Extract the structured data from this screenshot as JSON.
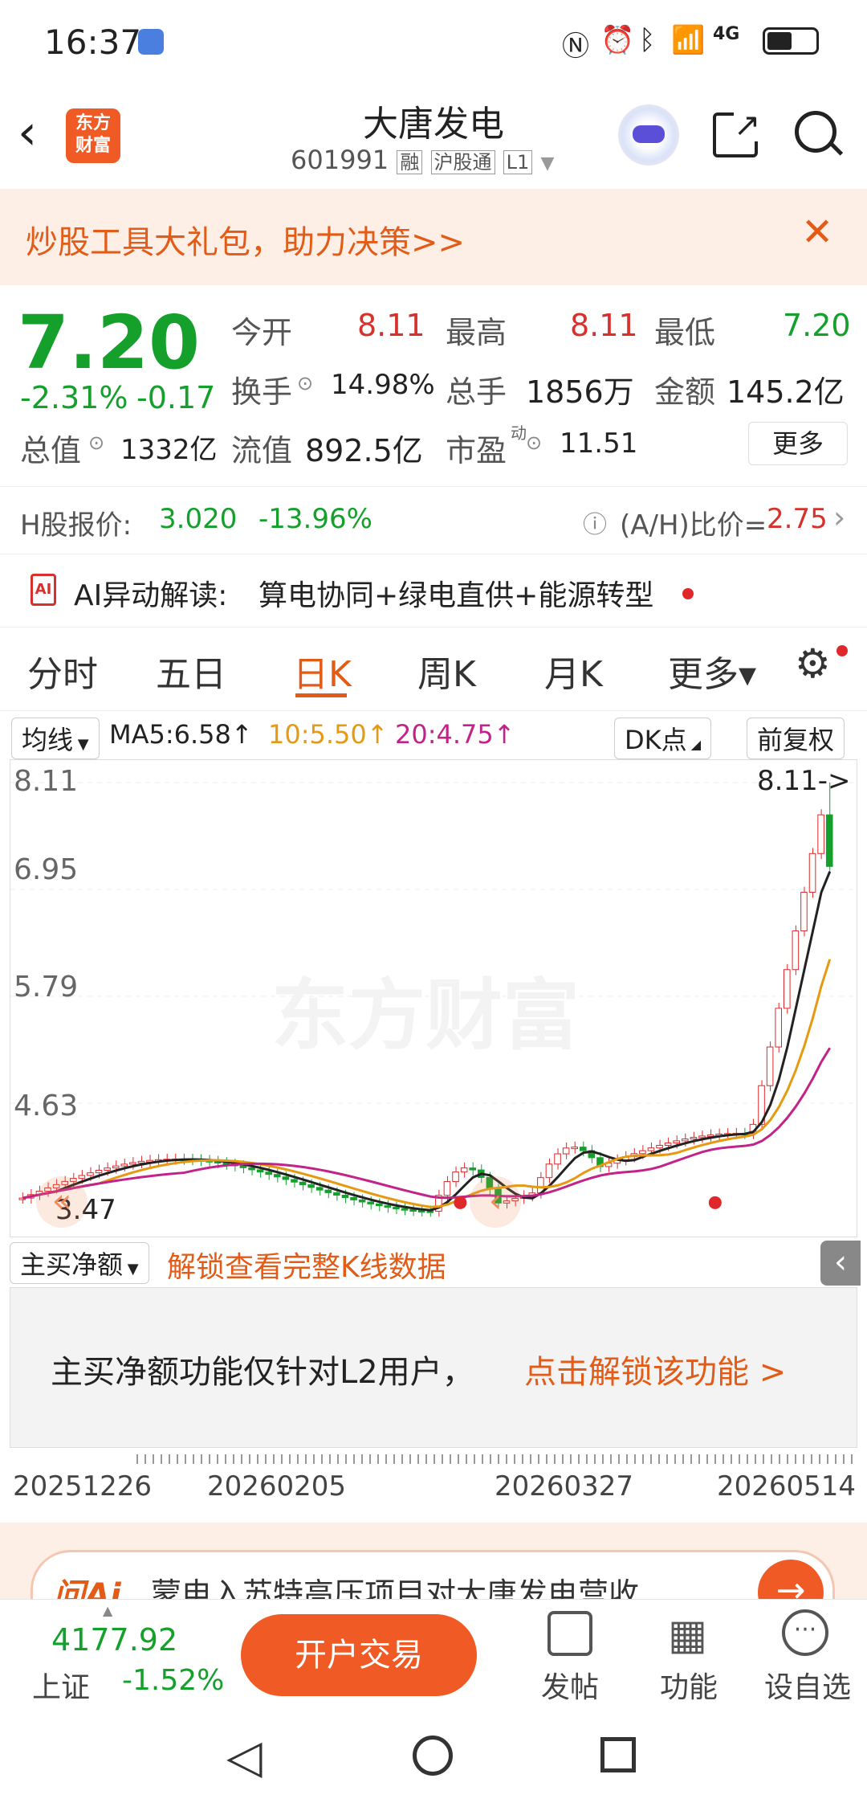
{
  "status": {
    "time": "16:37",
    "network": "4G"
  },
  "header": {
    "logo_text": "东方\n财富",
    "title": "大唐发电",
    "code": "601991",
    "badge_rong": "融",
    "badge_hgt": "沪股通",
    "badge_l1": "L1"
  },
  "banner": {
    "text": "炒股工具大礼包，助力决策>>"
  },
  "quote": {
    "price": "7.20",
    "change_pct": "-2.31%",
    "change": "-0.17",
    "open_label": "今开",
    "open": "8.11",
    "high_label": "最高",
    "high": "8.11",
    "low_label": "最低",
    "low": "7.20",
    "turnover_label": "换手",
    "turnover": "14.98%",
    "volume_label": "总手",
    "volume": "1856万",
    "amount_label": "金额",
    "amount": "145.2亿",
    "mcap_label": "总值",
    "mcap": "1332亿",
    "float_label": "流值",
    "float": "892.5亿",
    "pe_label": "市盈",
    "pe_sup": "动",
    "pe": "11.51",
    "more": "更多"
  },
  "hshare": {
    "label": "H股报价:",
    "price": "3.020",
    "pct": "-13.96%",
    "ah_label": "(A/H)比价=",
    "ah": "2.75"
  },
  "ai": {
    "label": "AI异动解读:",
    "text": "算电协同+绿电直供+能源转型"
  },
  "tabs": [
    "分时",
    "五日",
    "日K",
    "周K",
    "月K",
    "更多▾"
  ],
  "active_tab": 2,
  "ma": {
    "selector": "均线",
    "ma5": "MA5:6.58↑",
    "ma10": "10:5.50↑",
    "ma20": "20:4.75↑",
    "dk": "DK点",
    "adj": "前复权",
    "c_ma5": "#222222",
    "c_ma10": "#e59a12",
    "c_ma20": "#c2238a"
  },
  "chart_data": {
    "type": "candlestick",
    "y_ticks": [
      "8.11",
      "6.95",
      "5.79",
      "4.63"
    ],
    "max_label": "8.11->",
    "min_label": "3.47",
    "ylim": [
      3.47,
      8.11
    ],
    "watermark": "东方财富",
    "x_ticks": [
      "20251226",
      "20260205",
      "20260327",
      "20260514"
    ]
  },
  "sub": {
    "selector": "主买净额",
    "unlock": "解锁查看完整K线数据",
    "msg": "主买净额功能仅针对L2用户，",
    "link": "点击解锁该功能 >"
  },
  "news": {
    "brand": "问Ai",
    "text": "蒙电入苏特高压项目对大唐发电营收"
  },
  "bottom": {
    "index_value": "4177.92",
    "index_name": "上证",
    "index_pct": "-1.52%",
    "trade": "开户交易",
    "post": "发帖",
    "func": "功能",
    "watch": "设自选"
  }
}
